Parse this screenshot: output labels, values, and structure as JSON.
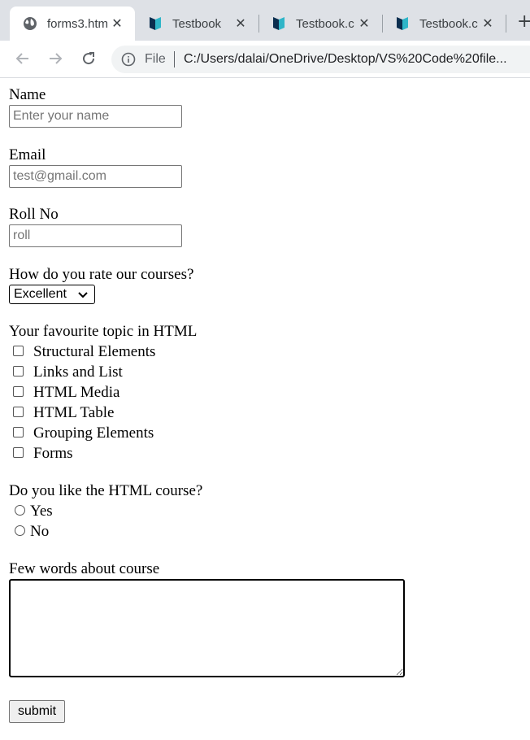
{
  "browser": {
    "tabs": [
      {
        "title": "forms3.htm",
        "icon": "globe-icon",
        "active": true
      },
      {
        "title": "Testbook",
        "icon": "testbook-icon",
        "active": false
      },
      {
        "title": "Testbook.c",
        "icon": "testbook-icon",
        "active": false
      },
      {
        "title": "Testbook.c",
        "icon": "testbook-icon",
        "active": false
      }
    ],
    "address": {
      "scheme": "File",
      "url": "C:/Users/dalai/OneDrive/Desktop/VS%20Code%20file..."
    }
  },
  "form": {
    "name": {
      "label": "Name",
      "placeholder": "Enter your name",
      "value": ""
    },
    "email": {
      "label": "Email",
      "placeholder": "test@gmail.com",
      "value": ""
    },
    "roll": {
      "label": "Roll No",
      "placeholder": "roll",
      "value": ""
    },
    "rating": {
      "label": "How do you rate our courses?",
      "selected": "Excellent"
    },
    "topics": {
      "label": "Your favourite topic in HTML",
      "options": [
        {
          "label": "Structural Elements",
          "checked": false
        },
        {
          "label": "Links and List",
          "checked": false
        },
        {
          "label": "HTML Media",
          "checked": false
        },
        {
          "label": "HTML Table",
          "checked": false
        },
        {
          "label": "Grouping Elements",
          "checked": false
        },
        {
          "label": "Forms",
          "checked": false
        }
      ]
    },
    "like": {
      "label": "Do you like the HTML course?",
      "options": [
        {
          "label": "Yes",
          "checked": false
        },
        {
          "label": "No",
          "checked": false
        }
      ]
    },
    "feedback": {
      "label": "Few words about course",
      "value": ""
    },
    "submit_label": "submit"
  }
}
